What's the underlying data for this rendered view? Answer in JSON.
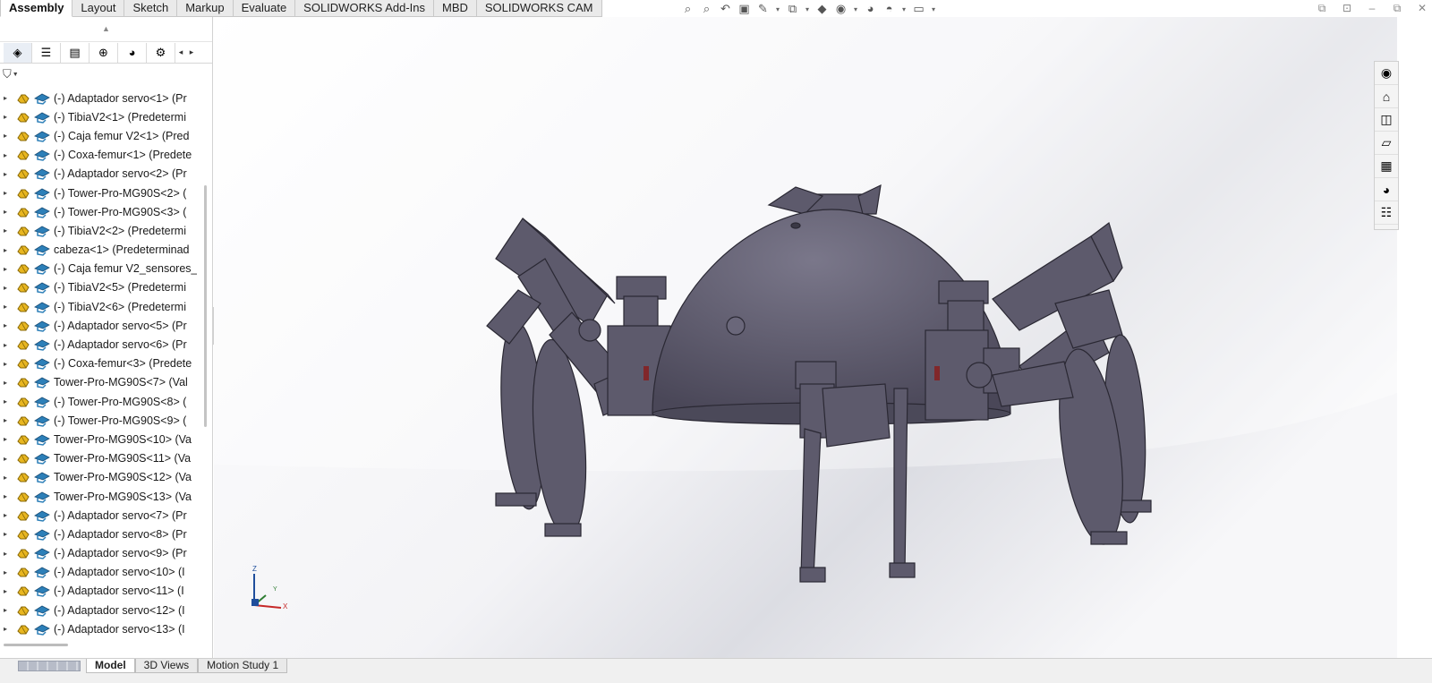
{
  "tabs": [
    "Assembly",
    "Layout",
    "Sketch",
    "Markup",
    "Evaluate",
    "SOLIDWORKS Add-Ins",
    "MBD",
    "SOLIDWORKS CAM"
  ],
  "active_tab": "Assembly",
  "view_toolbar": [
    {
      "icon": "zoom-to-fit-icon",
      "glyph": "⌕"
    },
    {
      "icon": "zoom-to-area-icon",
      "glyph": "⌕"
    },
    {
      "icon": "previous-view-icon",
      "glyph": "↶"
    },
    {
      "icon": "section-view-icon",
      "glyph": "▣"
    },
    {
      "icon": "dynamic-annotation-icon",
      "glyph": "✎"
    },
    {
      "icon": "view-orientation-icon",
      "glyph": "⧉"
    },
    {
      "icon": "display-style-icon",
      "glyph": "◆"
    },
    {
      "icon": "hide-show-items-icon",
      "glyph": "◉"
    },
    {
      "icon": "edit-appearance-icon",
      "glyph": "◕"
    },
    {
      "icon": "apply-scene-icon",
      "glyph": "◓"
    },
    {
      "icon": "view-settings-icon",
      "glyph": "▭"
    }
  ],
  "window_controls": [
    {
      "icon": "restore-panel-icon",
      "glyph": "⧉"
    },
    {
      "icon": "float-window-icon",
      "glyph": "⊡"
    },
    {
      "icon": "minimize-icon",
      "glyph": "–"
    },
    {
      "icon": "maximize-icon",
      "glyph": "⧉"
    },
    {
      "icon": "close-icon",
      "glyph": "✕"
    }
  ],
  "manager_tabs": [
    {
      "icon": "featuremanager-icon",
      "glyph": "◈"
    },
    {
      "icon": "propertymanager-icon",
      "glyph": "☰"
    },
    {
      "icon": "configurationmanager-icon",
      "glyph": "▤"
    },
    {
      "icon": "dimxpertmanager-icon",
      "glyph": "⊕"
    },
    {
      "icon": "displaymanager-icon",
      "glyph": "◕"
    },
    {
      "icon": "cam-manager-icon",
      "glyph": "⚙"
    }
  ],
  "tree_items": [
    "(-) Adaptador servo<1> (Pr",
    "(-) TibiaV2<1> (Predetermi",
    "(-) Caja femur V2<1> (Pred",
    "(-) Coxa-femur<1> (Predete",
    "(-) Adaptador servo<2> (Pr",
    "(-) Tower-Pro-MG90S<2> (",
    "(-) Tower-Pro-MG90S<3> (",
    "(-) TibiaV2<2> (Predetermi",
    "cabeza<1> (Predeterminad",
    "(-) Caja femur V2_sensores_",
    "(-) TibiaV2<5> (Predetermi",
    "(-) TibiaV2<6> (Predetermi",
    "(-) Adaptador servo<5> (Pr",
    "(-) Adaptador servo<6> (Pr",
    "(-) Coxa-femur<3> (Predete",
    "Tower-Pro-MG90S<7> (Val",
    "(-) Tower-Pro-MG90S<8> (",
    "(-) Tower-Pro-MG90S<9> (",
    "Tower-Pro-MG90S<10> (Va",
    "Tower-Pro-MG90S<11> (Va",
    "Tower-Pro-MG90S<12> (Va",
    "Tower-Pro-MG90S<13> (Va",
    "(-) Adaptador servo<7> (Pr",
    "(-) Adaptador servo<8> (Pr",
    "(-) Adaptador servo<9> (Pr",
    "(-) Adaptador servo<10> (I",
    "(-) Adaptador servo<11> (I",
    "(-) Adaptador servo<12> (I",
    "(-) Adaptador servo<13> (I"
  ],
  "task_pane": [
    {
      "icon": "solidworks-resources-icon",
      "glyph": "◉"
    },
    {
      "icon": "home-icon",
      "glyph": "⌂"
    },
    {
      "icon": "design-library-icon",
      "glyph": "◫"
    },
    {
      "icon": "file-explorer-icon",
      "glyph": "▱"
    },
    {
      "icon": "view-palette-icon",
      "glyph": "▦"
    },
    {
      "icon": "appearances-icon",
      "glyph": "◕"
    },
    {
      "icon": "custom-properties-icon",
      "glyph": "☷"
    }
  ],
  "triad": {
    "z": "Z",
    "y": "Y",
    "x": "X"
  },
  "bottom_tabs": [
    "Model",
    "3D Views",
    "Motion Study 1"
  ],
  "active_bottom_tab": "Model",
  "colors": {
    "model": "#5d5a6c",
    "model_dark": "#2a2833",
    "accent": "#1f4e9c"
  }
}
